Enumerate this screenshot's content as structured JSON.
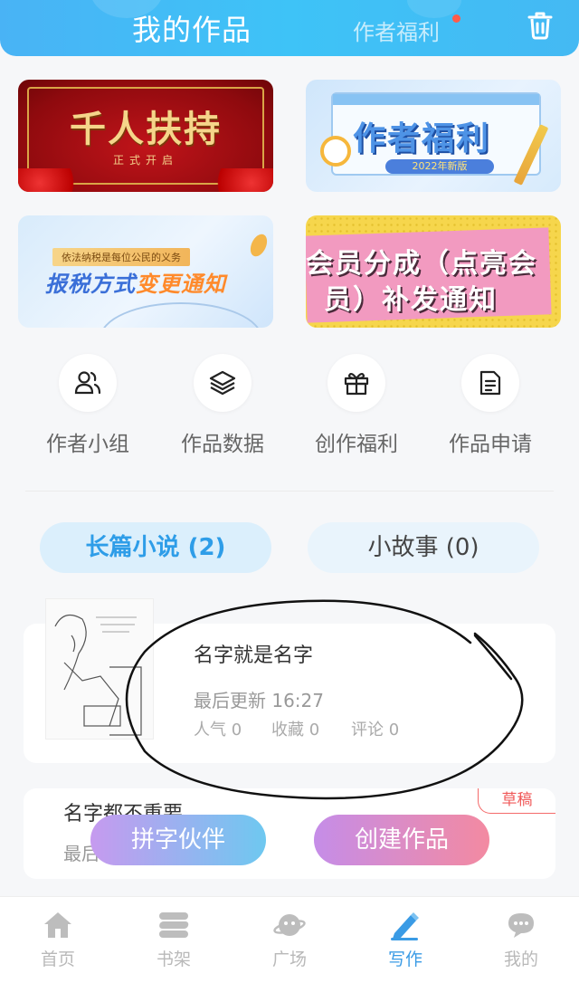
{
  "header": {
    "tab_active": "我的作品",
    "tab_inactive": "作者福利",
    "accent": "#46b6f5"
  },
  "banners": [
    {
      "main": "千人扶持",
      "sub": "正式开启"
    },
    {
      "main": "作者福利",
      "sub": "2022年新版"
    },
    {
      "tag": "依法纳税是每位公民的义务",
      "main_a": "报税方式",
      "main_b": "变更通知"
    },
    {
      "line1": "会员分成（点亮会",
      "line2": "员）补发通知"
    }
  ],
  "quick_actions": [
    {
      "label": "作者小组",
      "icon": "group-icon"
    },
    {
      "label": "作品数据",
      "icon": "layers-icon"
    },
    {
      "label": "创作福利",
      "icon": "gift-icon"
    },
    {
      "label": "作品申请",
      "icon": "document-icon"
    }
  ],
  "tabs": [
    {
      "label": "长篇小说 (2)",
      "active": true
    },
    {
      "label": "小故事 (0)",
      "active": false
    }
  ],
  "works": [
    {
      "title": "名字就是名字",
      "updated": "最后更新 16:27",
      "stats": [
        "人气 0",
        "收藏 0",
        "评论 0"
      ]
    },
    {
      "title": "名字都不重要",
      "updated": "最后",
      "badge": "草稿"
    }
  ],
  "actions": {
    "partner": "拼字伙伴",
    "create": "创建作品"
  },
  "bottom_nav": [
    {
      "label": "首页",
      "icon": "home-icon"
    },
    {
      "label": "书架",
      "icon": "bookshelf-icon"
    },
    {
      "label": "广场",
      "icon": "planet-icon"
    },
    {
      "label": "写作",
      "icon": "pen-icon",
      "active": true
    },
    {
      "label": "我的",
      "icon": "chat-icon"
    }
  ]
}
